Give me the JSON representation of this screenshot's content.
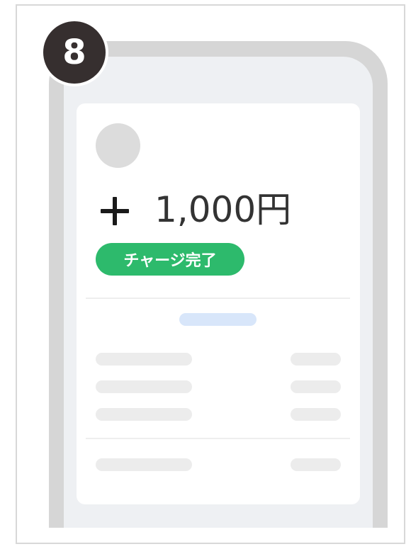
{
  "step": {
    "number": "8"
  },
  "transaction": {
    "sign": "+",
    "amount": "1,000円",
    "status": "チャージ完了"
  },
  "colors": {
    "badge_bg": "#362f2f",
    "status_green": "#2dba6c",
    "phone_frame": "#d6d6d6",
    "screen_bg": "#eef0f3",
    "link_placeholder": "#d8e6fa",
    "skeleton": "#ececec"
  },
  "icons": {
    "avatar": "avatar-placeholder",
    "sign": "plus-icon"
  },
  "details": {
    "rows": [
      {
        "label": "",
        "value": ""
      },
      {
        "label": "",
        "value": ""
      },
      {
        "label": "",
        "value": ""
      }
    ],
    "total": {
      "label": "",
      "value": ""
    }
  }
}
